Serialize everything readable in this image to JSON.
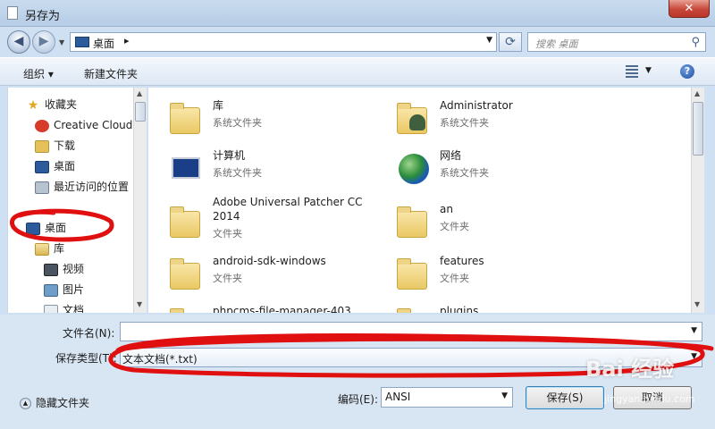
{
  "window": {
    "title": "另存为",
    "close_glyph": "✕"
  },
  "address": {
    "location": "桌面",
    "separator": "▸",
    "search_placeholder": "搜索 桌面"
  },
  "toolbar": {
    "organize": "组织 ▾",
    "new_folder": "新建文件夹",
    "help": "?"
  },
  "nav": {
    "items": [
      {
        "label": "收藏夹",
        "icon": "star-icon"
      },
      {
        "label": "Creative Cloud",
        "icon": "creative-cloud-icon"
      },
      {
        "label": "下载",
        "icon": "download-folder-icon"
      },
      {
        "label": "桌面",
        "icon": "desktop-icon"
      },
      {
        "label": "最近访问的位置",
        "icon": "recent-places-icon"
      },
      {
        "label": "桌面",
        "icon": "desktop-icon"
      },
      {
        "label": "库",
        "icon": "library-icon"
      },
      {
        "label": "视频",
        "icon": "video-icon"
      },
      {
        "label": "图片",
        "icon": "pictures-icon"
      },
      {
        "label": "文档",
        "icon": "documents-icon"
      }
    ]
  },
  "files": [
    {
      "name": "库",
      "type": "系统文件夹",
      "icon": "library-folder-icon"
    },
    {
      "name": "Administrator",
      "type": "系统文件夹",
      "icon": "user-folder-icon"
    },
    {
      "name": "计算机",
      "type": "系统文件夹",
      "icon": "computer-icon"
    },
    {
      "name": "网络",
      "type": "系统文件夹",
      "icon": "network-icon"
    },
    {
      "name": "Adobe Universal Patcher CC 2014",
      "type": "文件夹",
      "icon": "folder-icon"
    },
    {
      "name": "an",
      "type": "文件夹",
      "icon": "folder-icon"
    },
    {
      "name": "android-sdk-windows",
      "type": "文件夹",
      "icon": "folder-icon"
    },
    {
      "name": "features",
      "type": "文件夹",
      "icon": "folder-icon"
    },
    {
      "name": "phpcms-file-manager-403",
      "type": "",
      "icon": "folder-icon"
    },
    {
      "name": "plugins",
      "type": "",
      "icon": "folder-icon"
    }
  ],
  "form": {
    "filename_label": "文件名(N):",
    "filename_value": "",
    "filetype_label": "保存类型(T):",
    "filetype_value": "文本文档(*.txt)",
    "hide_folders": "隐藏文件夹",
    "encoding_label": "编码(E):",
    "encoding_value": "ANSI",
    "save": "保存(S)",
    "cancel": "取消"
  },
  "watermark": {
    "main": "Bai 经验",
    "sub": "jingyan.baidu.com"
  },
  "colors": {
    "annotation": "#e01010",
    "window_frame": "#cfe0f3"
  }
}
